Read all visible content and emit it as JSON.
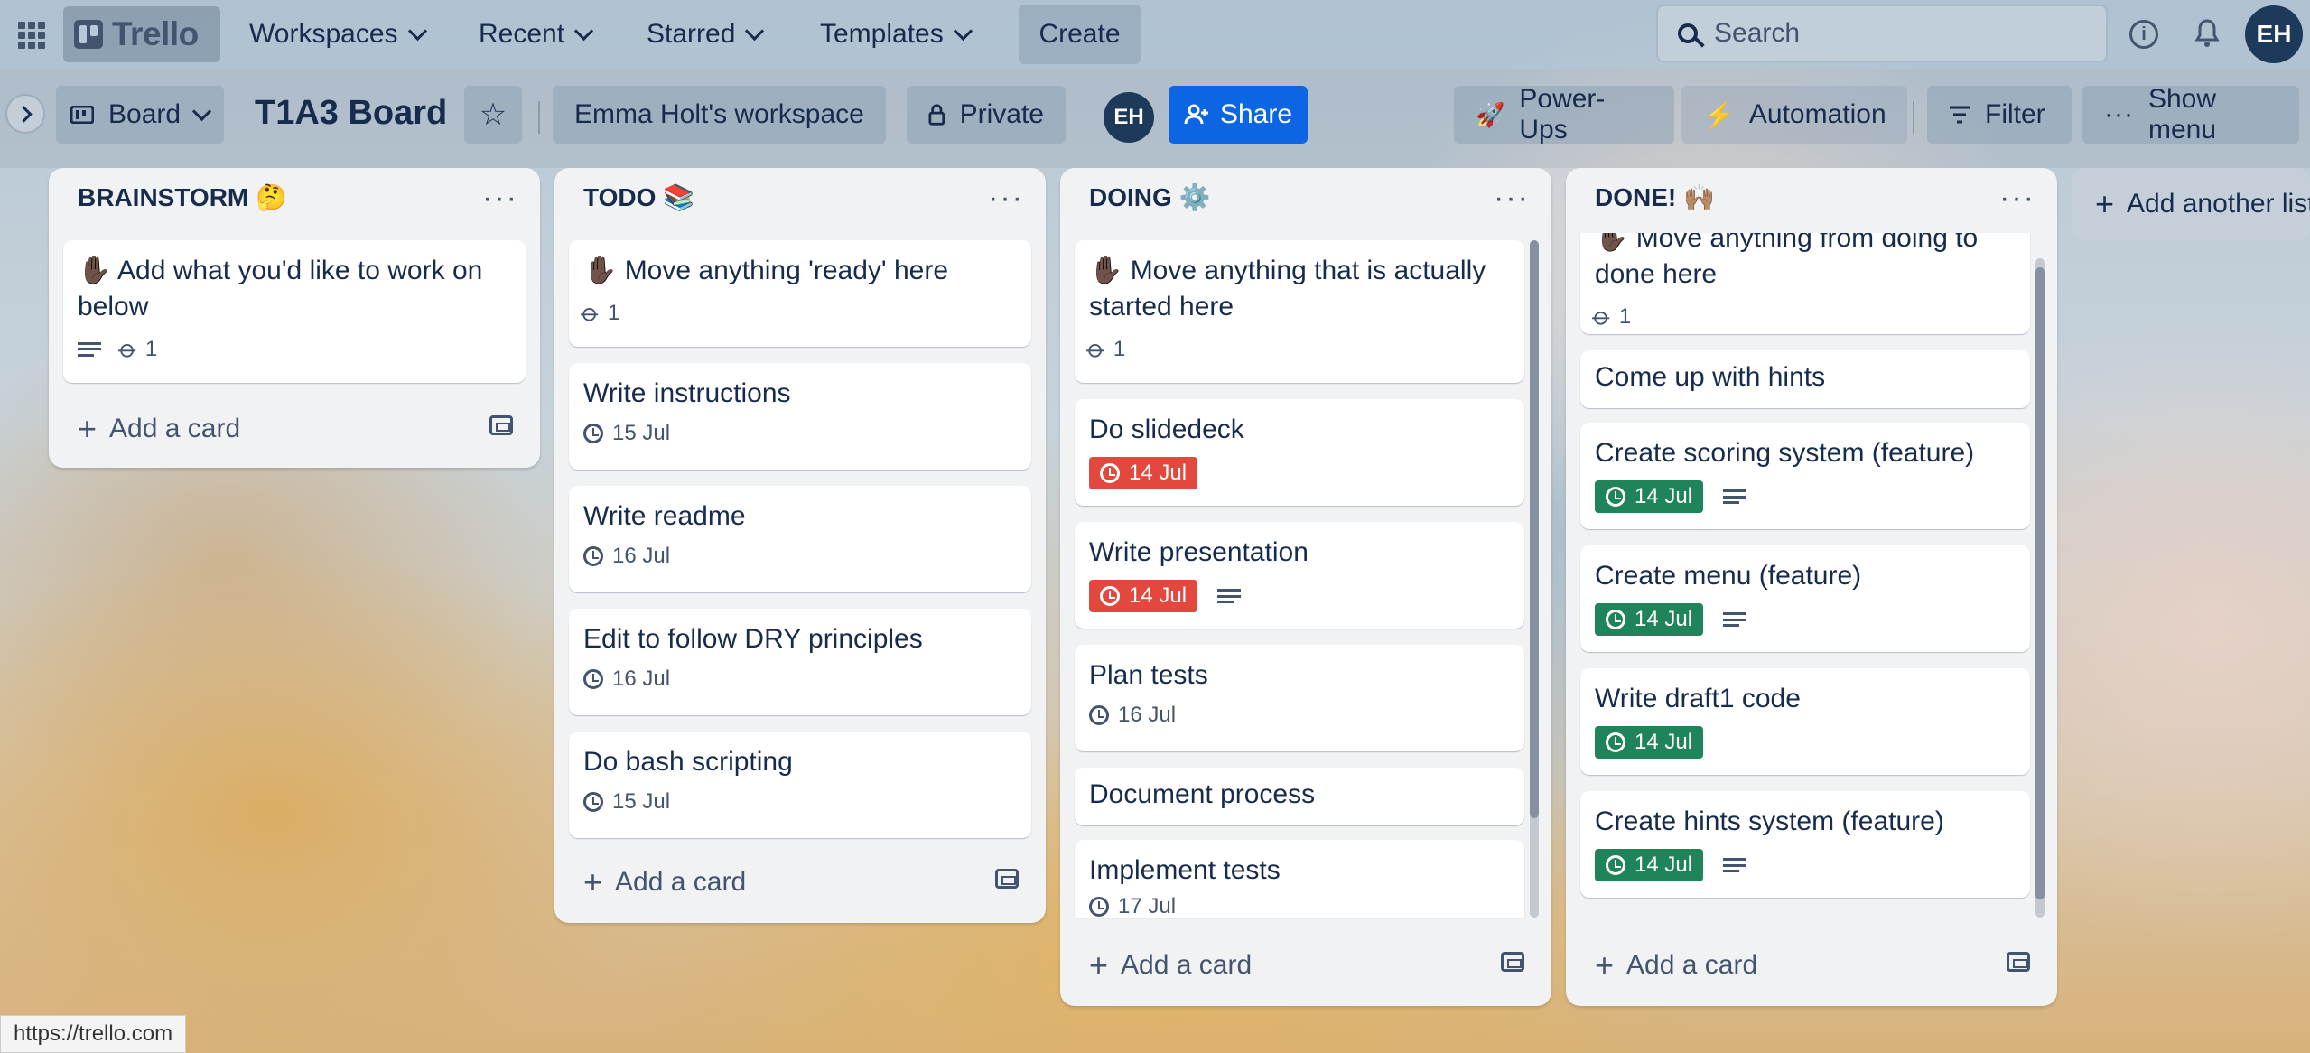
{
  "topnav": {
    "logo": "Trello",
    "workspaces": "Workspaces",
    "recent": "Recent",
    "starred": "Starred",
    "templates": "Templates",
    "create": "Create",
    "search_placeholder": "Search",
    "avatar": "EH"
  },
  "boardbar": {
    "view": "Board",
    "title": "T1A3 Board",
    "workspace": "Emma Holt's workspace",
    "visibility": "Private",
    "avatar": "EH",
    "share": "Share",
    "powerups": "Power-Ups",
    "automation": "Automation",
    "filter": "Filter",
    "show_menu": "Show menu"
  },
  "lists": [
    {
      "name": "BRAINSTORM 🤔",
      "cards": [
        {
          "title": "✋🏿 Add what you'd like to work on below",
          "attachments": "1"
        }
      ],
      "add": "Add a card"
    },
    {
      "name": "TODO 📚",
      "cards": [
        {
          "title": "✋🏿 Move anything 'ready' here",
          "attachments": "1"
        },
        {
          "title": "Write instructions",
          "date": "15 Jul"
        },
        {
          "title": "Write readme",
          "date": "16 Jul"
        },
        {
          "title": "Edit to follow DRY principles",
          "date": "16 Jul"
        },
        {
          "title": "Do bash scripting",
          "date": "15 Jul"
        }
      ],
      "add": "Add a card"
    },
    {
      "name": "DOING ⚙️",
      "cards": [
        {
          "title": "✋🏿 Move anything that is actually started here",
          "attachments": "1"
        },
        {
          "title": "Do slidedeck",
          "date": "14 Jul"
        },
        {
          "title": "Write presentation",
          "date": "14 Jul"
        },
        {
          "title": "Plan tests",
          "date": "16 Jul"
        },
        {
          "title": "Document process"
        },
        {
          "title": "Implement tests",
          "date": "17 Jul"
        }
      ],
      "add": "Add a card"
    },
    {
      "name": "DONE! 🙌🏽",
      "cards": [
        {
          "title": "✋🏿 Move anything from doing to done here",
          "attachments": "1"
        },
        {
          "title": "Come up with hints"
        },
        {
          "title": "Create scoring system (feature)",
          "date": "14 Jul"
        },
        {
          "title": "Create menu (feature)",
          "date": "14 Jul"
        },
        {
          "title": "Write draft1 code",
          "date": "14 Jul"
        },
        {
          "title": "Create hints system (feature)",
          "date": "14 Jul"
        }
      ],
      "add": "Add a card"
    }
  ],
  "add_list": "Add another list",
  "status_url": "https://trello.com",
  "colors": {
    "overdue": "#e2483d",
    "complete": "#1f845a",
    "share": "#0c66e4"
  }
}
